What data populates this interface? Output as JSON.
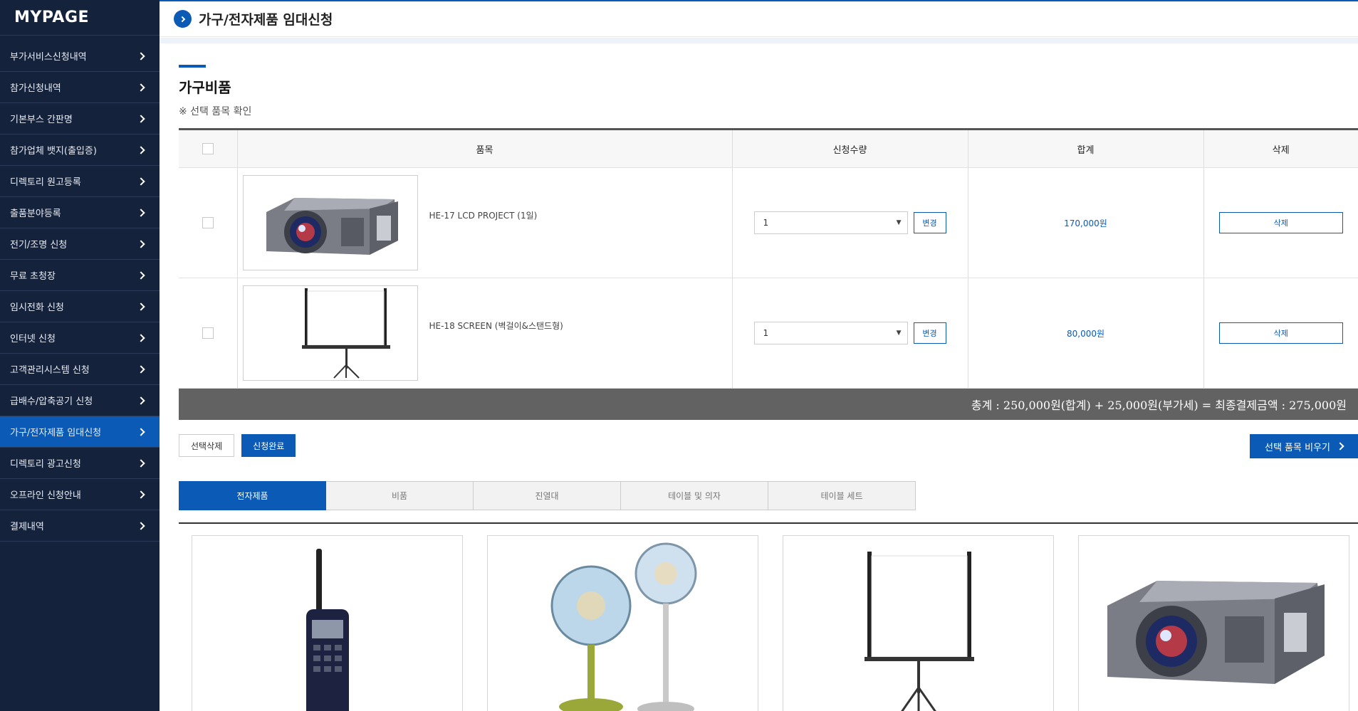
{
  "sidebar": {
    "brand": "MYPAGE",
    "items": [
      {
        "label": "부가서비스신청내역"
      },
      {
        "label": "참가신청내역"
      },
      {
        "label": "기본부스 간판명"
      },
      {
        "label": "참가업체 뱃지(출입증)"
      },
      {
        "label": "디렉토리 원고등록"
      },
      {
        "label": "출품분야등록"
      },
      {
        "label": "전기/조명 신청"
      },
      {
        "label": "무료 초청장"
      },
      {
        "label": "임시전화 신청"
      },
      {
        "label": "인터넷 신청"
      },
      {
        "label": "고객관리시스템 신청"
      },
      {
        "label": "급배수/압축공기 신청"
      },
      {
        "label": "가구/전자제품 임대신청"
      },
      {
        "label": "디렉토리 광고신청"
      },
      {
        "label": "오프라인 신청안내"
      },
      {
        "label": "결제내역"
      }
    ],
    "active_index": 12
  },
  "header": {
    "title": "가구/전자제품 임대신청"
  },
  "section": {
    "title": "가구비품",
    "note": "※ 선택 품목 확인"
  },
  "cart": {
    "columns": [
      "품목",
      "신청수량",
      "합계",
      "삭제"
    ],
    "rows": [
      {
        "name": "HE-17 LCD PROJECT (1일)",
        "qty": "1",
        "change_label": "변경",
        "total": "170,000원",
        "delete_label": "삭제",
        "image": "projector"
      },
      {
        "name": "HE-18 SCREEN (벽걸이&스탠드형)",
        "qty": "1",
        "change_label": "변경",
        "total": "80,000원",
        "delete_label": "삭제",
        "image": "screen"
      }
    ],
    "summary": "총계 : 250,000원(합계) + 25,000원(부가세) = 최종결제금액 : 275,000원"
  },
  "actions": {
    "delete_selected": "선택삭제",
    "complete": "신청완료",
    "clear_selected": "선택 품목 비우기"
  },
  "tabs": [
    {
      "label": "전자제품",
      "active": true
    },
    {
      "label": "비품",
      "active": false
    },
    {
      "label": "진열대",
      "active": false
    },
    {
      "label": "테이블 및 의자",
      "active": false
    },
    {
      "label": "테이블 세트",
      "active": false
    }
  ],
  "products": [
    {
      "image": "walkie-talkie"
    },
    {
      "image": "fans"
    },
    {
      "image": "screen"
    },
    {
      "image": "projector"
    }
  ],
  "colors": {
    "primary": "#0a5ab6",
    "sidebar": "#15223b",
    "total_bar": "#626262"
  }
}
